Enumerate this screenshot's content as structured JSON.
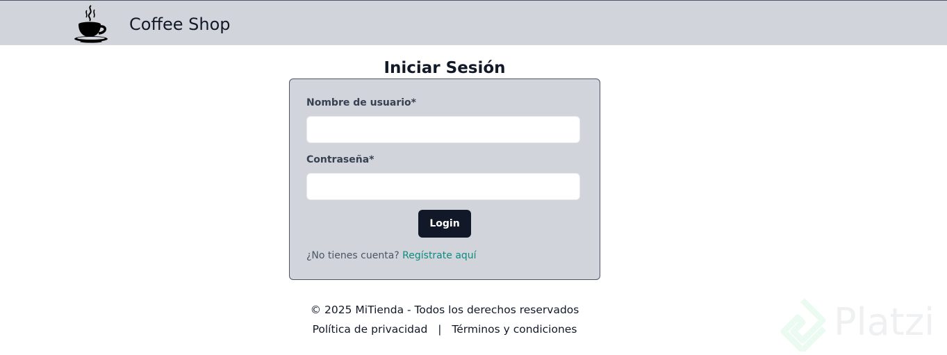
{
  "navbar": {
    "brand": "Coffee Shop",
    "logo_icon": "coffee-cup-icon"
  },
  "login": {
    "title": "Iniciar Sesión",
    "username_label": "Nombre de usuario*",
    "username_value": "",
    "password_label": "Contraseña*",
    "password_value": "",
    "button_label": "Login",
    "signup_prompt": "¿No tienes cuenta?",
    "signup_link": "Regístrate aquí"
  },
  "footer": {
    "copyright": "© 2025 MiTienda - Todos los derechos reservados",
    "privacy": "Política de privacidad",
    "separator": "|",
    "terms": "Términos y condiciones"
  },
  "watermark": {
    "text": "Platzi"
  },
  "colors": {
    "navbar_bg": "#d1d5db",
    "card_bg": "#d1d5db",
    "button_bg": "#111827",
    "link": "#0f8a7e"
  }
}
